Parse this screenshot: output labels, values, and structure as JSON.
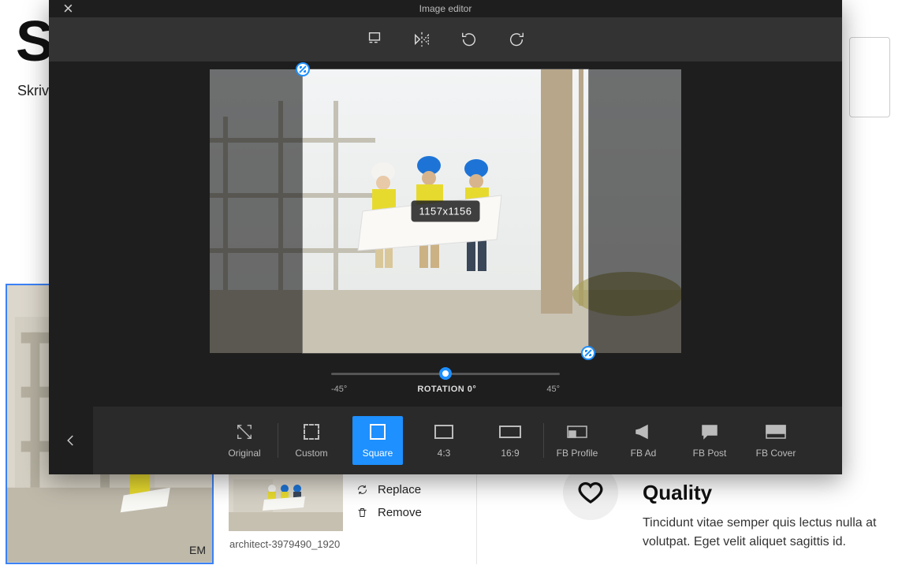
{
  "background": {
    "title_visible": "S",
    "subtitle_visible": "Skriv",
    "thumb_label": "EM",
    "thumb2_filename": "architect-3979490_1920",
    "replace_label": "Replace",
    "remove_label": "Remove",
    "quality_title": "Quality",
    "quality_body": "Tincidunt vitae semper quis lectus nulla at volutpat. Eget velit aliquet sagittis id."
  },
  "modal": {
    "title": "Image editor",
    "crop_dimensions": "1157x1156",
    "rotation": {
      "min_label": "-45°",
      "max_label": "45°",
      "center_label": "ROTATION 0°"
    },
    "presets": [
      {
        "key": "original",
        "label": "Original"
      },
      {
        "key": "custom",
        "label": "Custom"
      },
      {
        "key": "square",
        "label": "Square"
      },
      {
        "key": "r43",
        "label": "4:3"
      },
      {
        "key": "r169",
        "label": "16:9"
      },
      {
        "key": "fbprofile",
        "label": "FB Profile"
      },
      {
        "key": "fbad",
        "label": "FB Ad"
      },
      {
        "key": "fbpost",
        "label": "FB Post"
      },
      {
        "key": "fbcover",
        "label": "FB Cover"
      }
    ]
  }
}
